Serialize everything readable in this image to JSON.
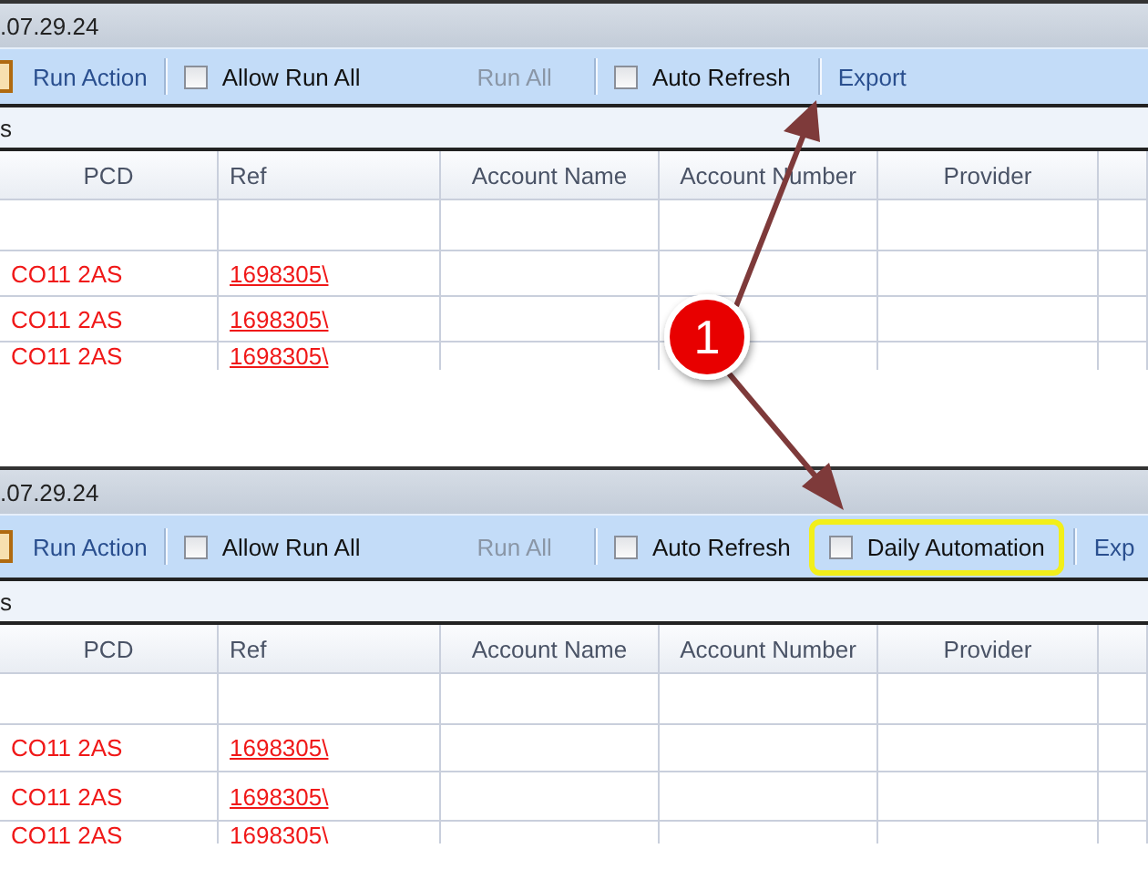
{
  "panels": [
    {
      "title": ".07.29.24",
      "toolbar": [
        {
          "kind": "edge-icon"
        },
        {
          "kind": "action",
          "label": "Run Action"
        },
        {
          "kind": "separator"
        },
        {
          "kind": "checkbox",
          "label": "Allow Run All",
          "checked": false
        },
        {
          "kind": "disabled",
          "label": "Run All"
        },
        {
          "kind": "separator"
        },
        {
          "kind": "checkbox",
          "label": "Auto Refresh",
          "checked": false
        },
        {
          "kind": "separator"
        },
        {
          "kind": "action",
          "label": "Export"
        }
      ],
      "strip": "s",
      "columns": [
        "PCD",
        "Ref",
        "Account Name",
        "Account Number",
        "Provider",
        ""
      ],
      "rows": [
        {
          "pcd": "",
          "ref": ""
        },
        {
          "pcd": "CO11 2AS",
          "ref": "1698305\\"
        },
        {
          "pcd": "CO11 2AS",
          "ref": "1698305\\"
        },
        {
          "pcd": "CO11 2AS",
          "ref": "1698305\\"
        }
      ]
    },
    {
      "title": ".07.29.24",
      "toolbar": [
        {
          "kind": "edge-icon"
        },
        {
          "kind": "action",
          "label": "Run Action"
        },
        {
          "kind": "separator"
        },
        {
          "kind": "checkbox",
          "label": "Allow Run All",
          "checked": false
        },
        {
          "kind": "disabled",
          "label": "Run All"
        },
        {
          "kind": "separator"
        },
        {
          "kind": "checkbox",
          "label": "Auto Refresh",
          "checked": false
        },
        {
          "kind": "checkbox",
          "label": "Daily Automation",
          "checked": false,
          "highlighted": true
        },
        {
          "kind": "separator"
        },
        {
          "kind": "action",
          "label": "Exp"
        }
      ],
      "strip": "s",
      "columns": [
        "PCD",
        "Ref",
        "Account Name",
        "Account Number",
        "Provider",
        ""
      ],
      "rows": [
        {
          "pcd": "",
          "ref": ""
        },
        {
          "pcd": "CO11 2AS",
          "ref": "1698305\\"
        },
        {
          "pcd": "CO11 2AS",
          "ref": "1698305\\"
        },
        {
          "pcd": "CO11 2AS",
          "ref": "1698305\\"
        }
      ]
    }
  ],
  "callout": {
    "label": "1"
  }
}
